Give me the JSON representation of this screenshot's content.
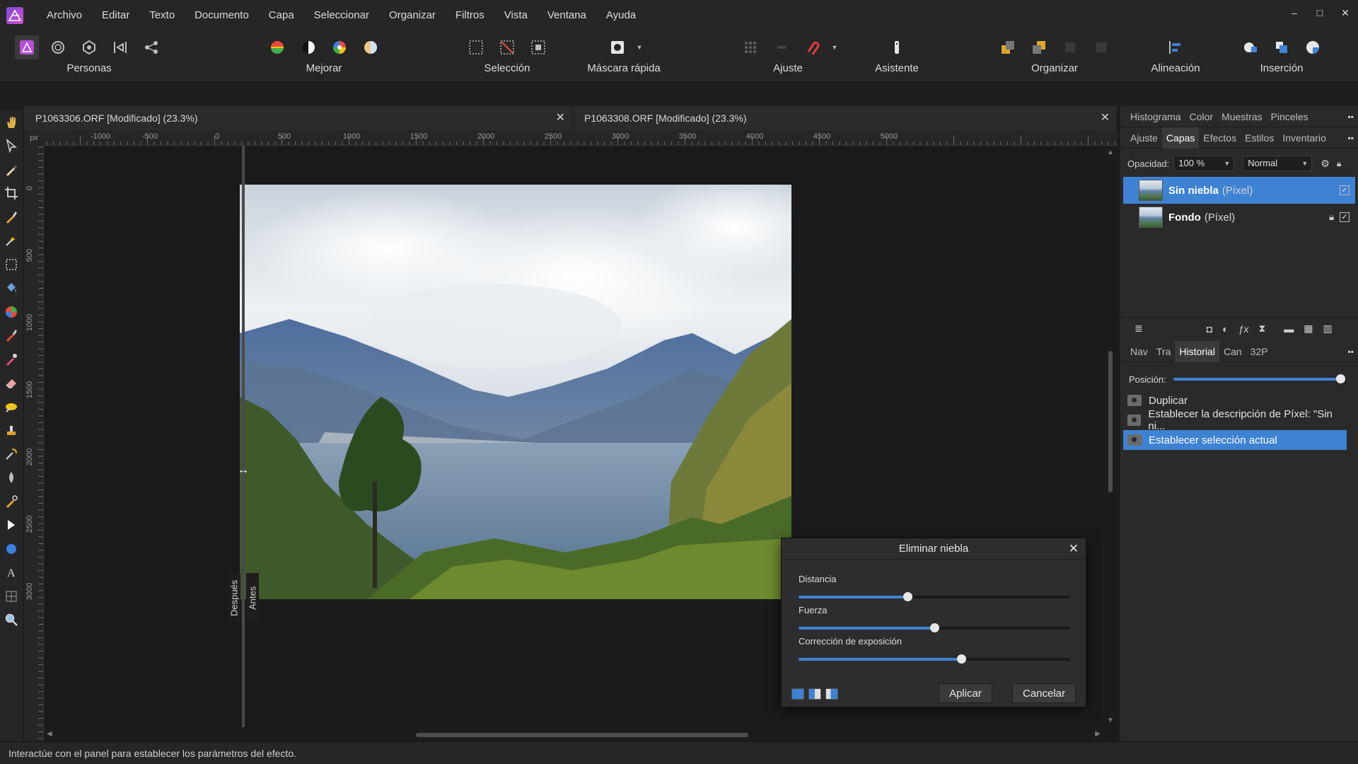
{
  "app": {
    "name": "Affinity Photo",
    "accent_color": "#3e82d4"
  },
  "menu": [
    "Archivo",
    "Editar",
    "Texto",
    "Documento",
    "Capa",
    "Seleccionar",
    "Organizar",
    "Filtros",
    "Vista",
    "Ventana",
    "Ayuda"
  ],
  "window_controls": {
    "minimize": "–",
    "maximize": "□",
    "close": "✕"
  },
  "toolbar": {
    "personas": "Personas",
    "mejorar": "Mejorar",
    "seleccion": "Selección",
    "mascara": "Máscara rápida",
    "ajuste": "Ajuste",
    "asistente": "Asistente",
    "organizar": "Organizar",
    "alineacion": "Alineación",
    "insercion": "Inserción"
  },
  "document_tabs": [
    {
      "title": "P1063306.ORF [Modificado] (23.3%)",
      "close": "✕"
    },
    {
      "title": "P1063308.ORF [Modificado] (23.3%)",
      "close": "✕"
    }
  ],
  "ruler": {
    "unit": "px",
    "top_labels": [
      "-1000",
      "-500",
      "0",
      "500",
      "1000",
      "1500",
      "2000",
      "2500",
      "3000",
      "3500",
      "4000",
      "4500",
      "5000"
    ],
    "left_labels": [
      "0",
      "500",
      "1000",
      "1500",
      "2000",
      "2500",
      "3000"
    ]
  },
  "split_view": {
    "after": "Después",
    "before": "Antes",
    "handle": "↔"
  },
  "panels": {
    "top_tabs": [
      "Histograma",
      "Color",
      "Muestras",
      "Pinceles"
    ],
    "layer_tabs": [
      "Ajuste",
      "Capas",
      "Efectos",
      "Estilos",
      "Inventario"
    ],
    "layer_tabs_active": "Capas",
    "opacity_label": "Opacidad:",
    "opacity_value": "100 %",
    "blend_mode": "Normal",
    "layers": [
      {
        "name": "Sin niebla",
        "kind": "(Píxel)",
        "selected": true,
        "visible": true,
        "locked": false
      },
      {
        "name": "Fondo",
        "kind": "(Píxel)",
        "selected": false,
        "visible": true,
        "locked": true
      }
    ],
    "history_tabs": [
      "Nav",
      "Tra",
      "Historial",
      "Can",
      "32P"
    ],
    "history_tabs_active": "Historial",
    "position_label": "Posición:",
    "history_position": 1.0,
    "history": [
      {
        "label": "Duplicar",
        "selected": false
      },
      {
        "label": "Establecer la descripción de Píxel: \"Sin ni...",
        "selected": false
      },
      {
        "label": "Establecer selección actual",
        "selected": true
      }
    ]
  },
  "dialog": {
    "title": "Eliminar niebla",
    "close": "✕",
    "sliders": [
      {
        "label": "Distancia",
        "value": 0.4
      },
      {
        "label": "Fuerza",
        "value": 0.5
      },
      {
        "label": "Corrección de exposición",
        "value": 0.6
      }
    ],
    "apply": "Aplicar",
    "cancel": "Cancelar"
  },
  "status": "Interactúe con el panel para establecer los parámetros del efecto."
}
